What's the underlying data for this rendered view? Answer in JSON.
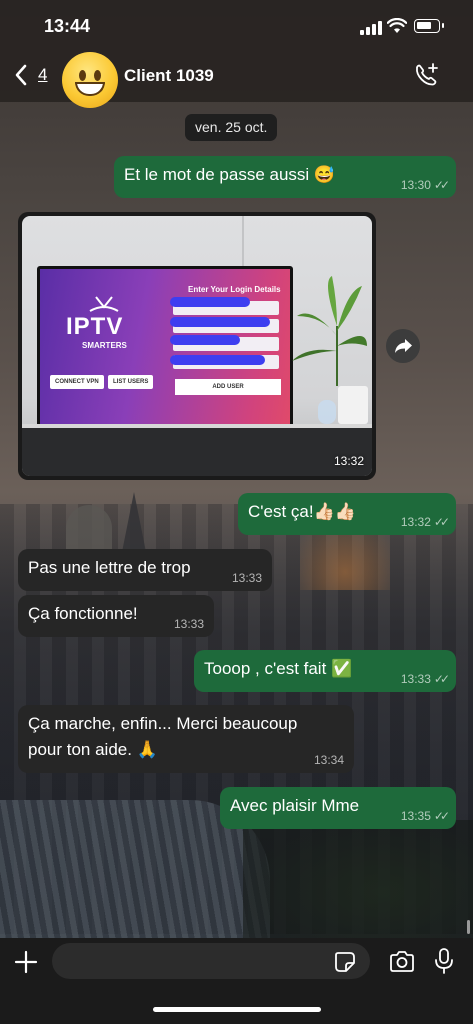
{
  "status_bar": {
    "time": "13:44"
  },
  "header": {
    "back_count": "4",
    "contact_name": "Client 1039"
  },
  "chat": {
    "date_chip": "ven. 25 oct.",
    "messages": [
      {
        "direction": "out",
        "text": "Et le mot de passe aussi 😅",
        "time": "13:30",
        "status": "read"
      },
      {
        "direction": "in",
        "type": "image",
        "time": "13:32"
      },
      {
        "direction": "out",
        "text": "C'est ça!👍🏻👍🏻",
        "time": "13:32",
        "status": "read"
      },
      {
        "direction": "in",
        "text": "Pas une lettre de trop",
        "time": "13:33"
      },
      {
        "direction": "in",
        "text": "Ça fonctionne!",
        "time": "13:33"
      },
      {
        "direction": "out",
        "text": "Tooop , c'est fait ✅",
        "time": "13:33",
        "status": "read"
      },
      {
        "direction": "in",
        "text_line1": "Ça marche, enfin... Merci beaucoup",
        "text_line2": "pour ton aide. 🙏",
        "time": "13:34"
      },
      {
        "direction": "out",
        "text": "Avec plaisir Mme",
        "time": "13:35",
        "status": "read"
      }
    ],
    "image_content": {
      "login_title": "Enter Your Login Details",
      "logo_text": "IPTV",
      "logo_subtext": "SMARTERS",
      "connect_vpn": "CONNECT VPN",
      "list_users": "LIST USERS",
      "add_user": "ADD USER"
    }
  },
  "colors": {
    "outgoing_bubble": "#1e6a3b",
    "incoming_bubble": "#262626",
    "header_bg": "#28241f",
    "composer_bg": "#1b1b1b"
  },
  "icons": {
    "back": "chevron-left-icon",
    "call": "phone-plus-icon",
    "forward": "forward-arrow-icon",
    "plus": "plus-icon",
    "sticker": "sticker-icon",
    "camera": "camera-icon",
    "mic": "microphone-icon"
  }
}
